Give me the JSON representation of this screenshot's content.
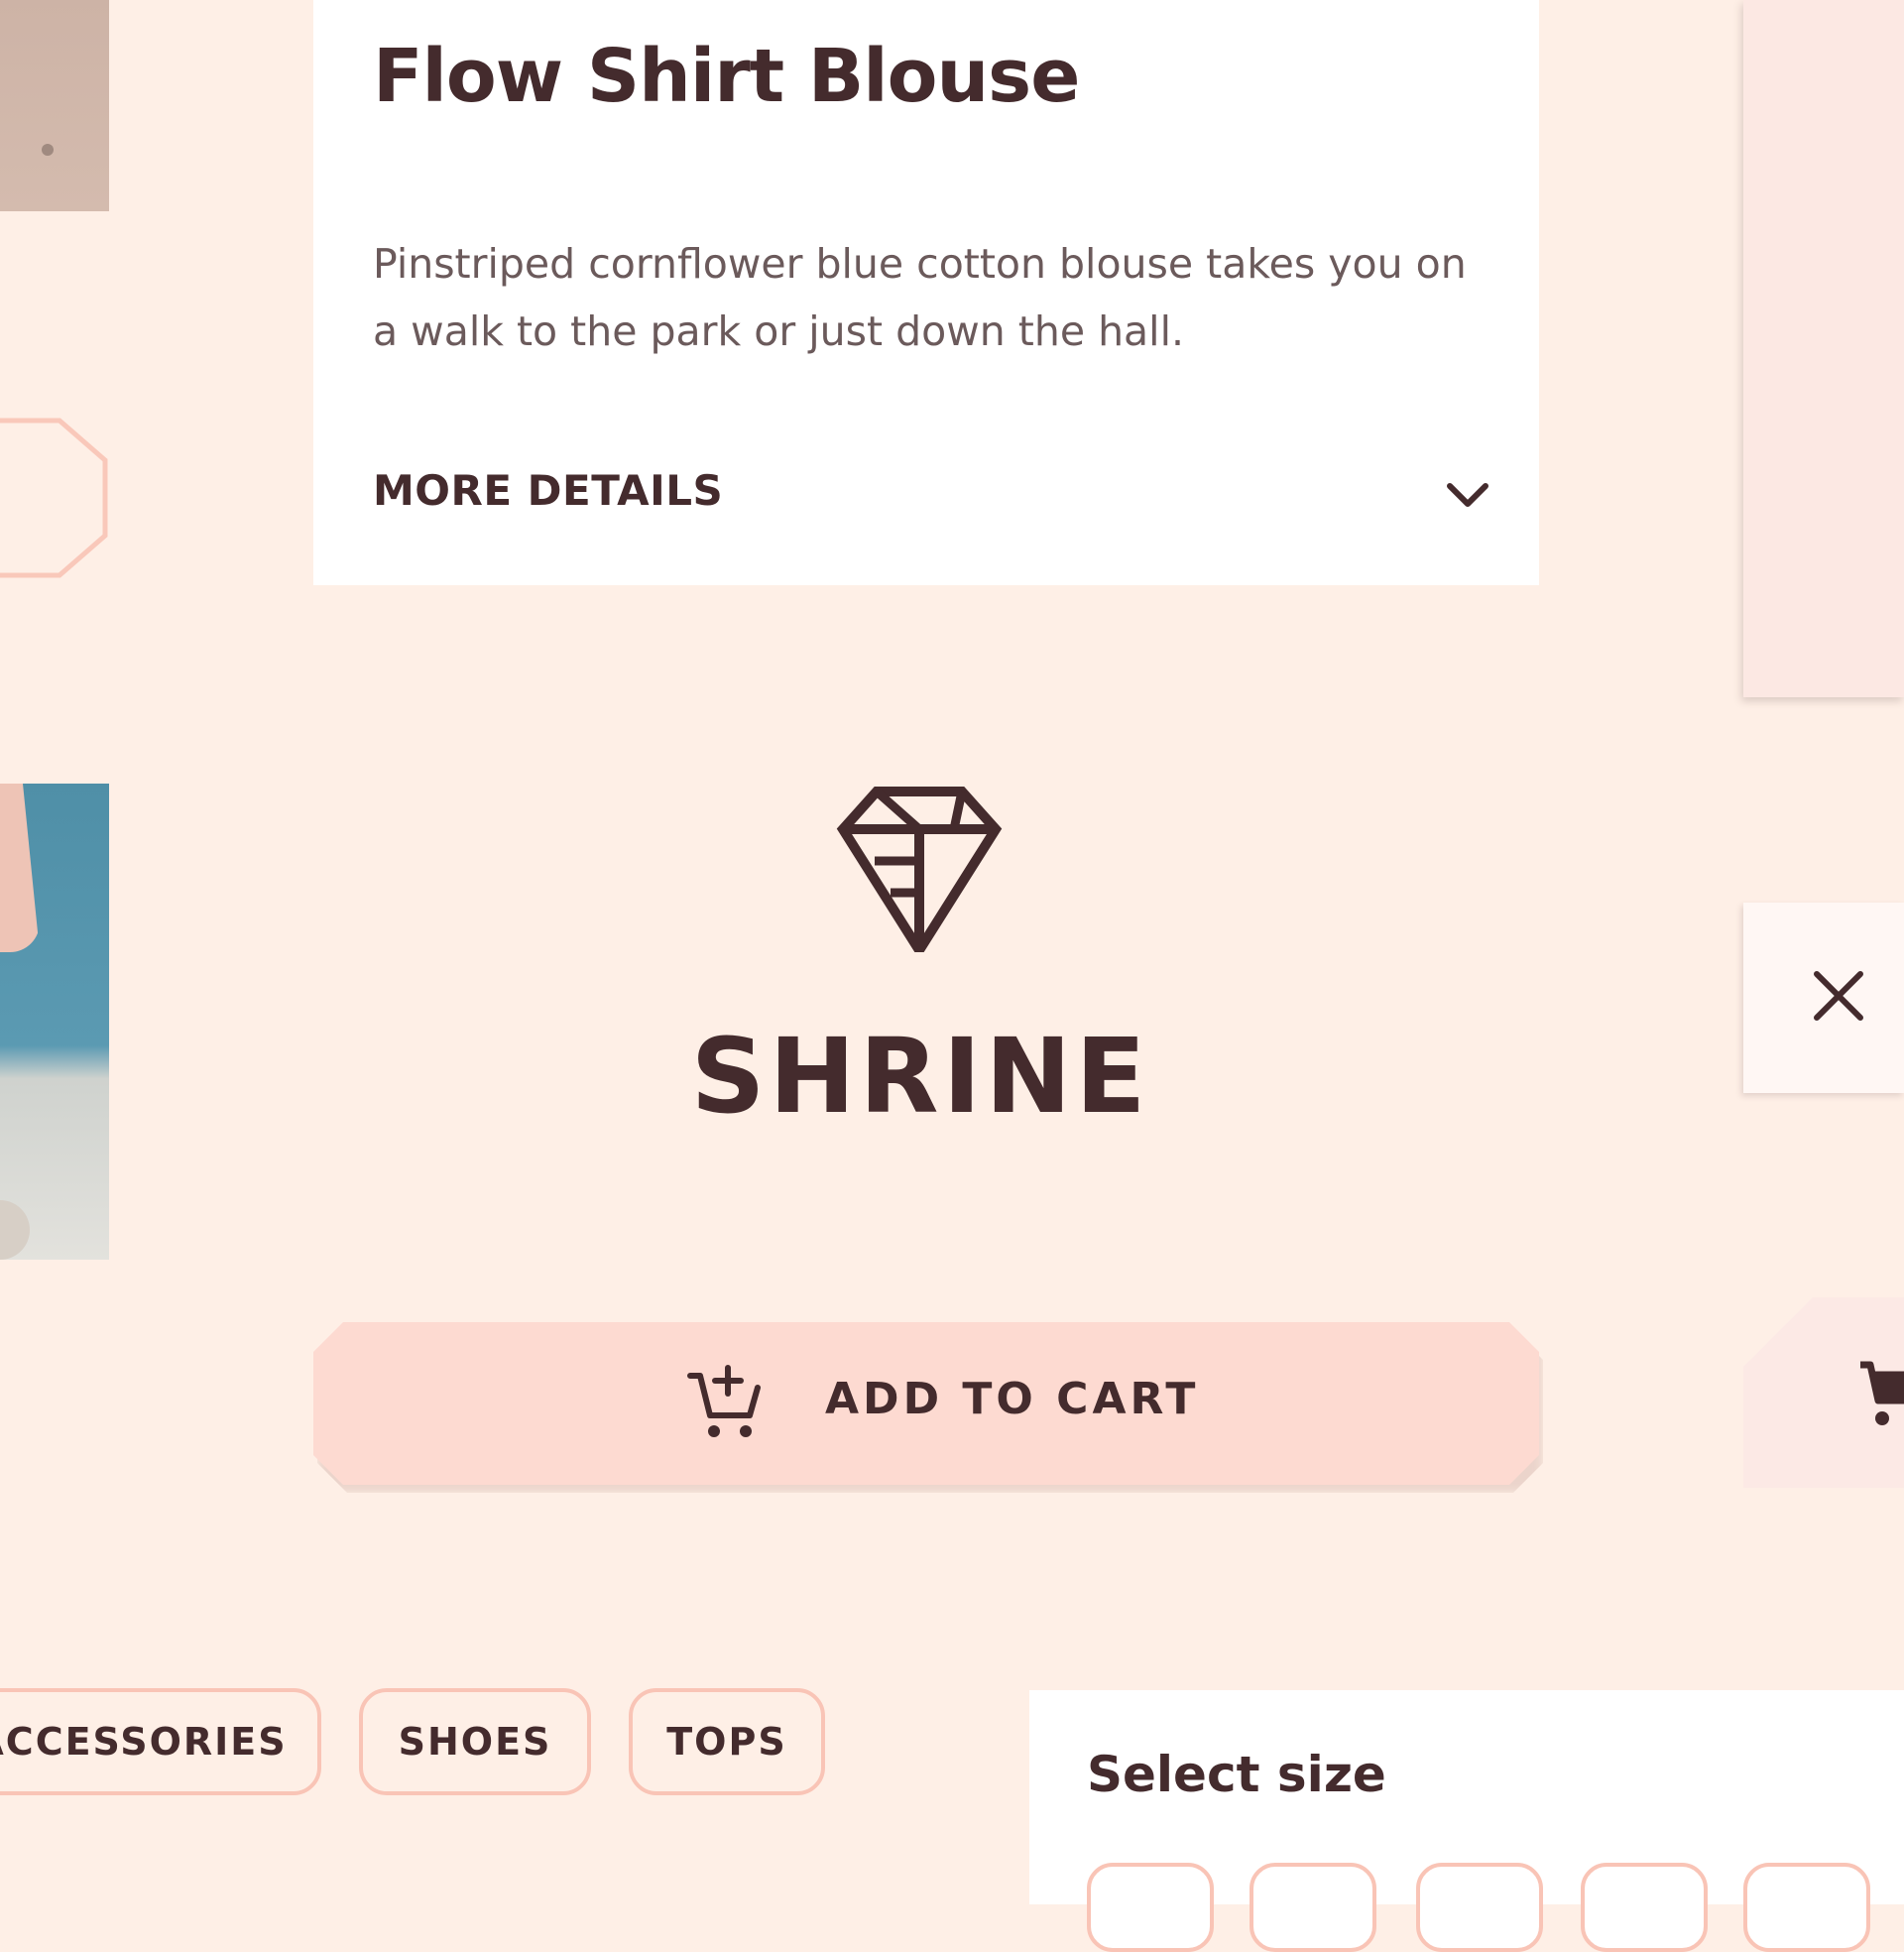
{
  "product": {
    "title": "Flow Shirt Blouse",
    "description": "Pinstriped cornflower blue cotton blouse takes you on a walk to the park or just down the hall.",
    "more_details_label": "MORE DETAILS"
  },
  "brand": {
    "name": "SHRINE",
    "logo_icon": "diamond-icon"
  },
  "actions": {
    "add_to_cart_label": "ADD TO CART",
    "add_to_cart_icon": "add-shopping-cart-icon",
    "close_icon": "close-icon",
    "cart_icon": "shopping-cart-icon"
  },
  "categories": [
    {
      "label": "ACCESSORIES"
    },
    {
      "label": "SHOES"
    },
    {
      "label": "TOPS"
    }
  ],
  "size_selector": {
    "title": "Select size",
    "options_visible": 5
  },
  "colors": {
    "background": "#FEEFE6",
    "primary_text": "#442B2D",
    "secondary_text": "#6B5A5B",
    "accent": "#FDDAD1",
    "chip_border": "#F9C4B6",
    "surface": "#FFFFFF"
  }
}
